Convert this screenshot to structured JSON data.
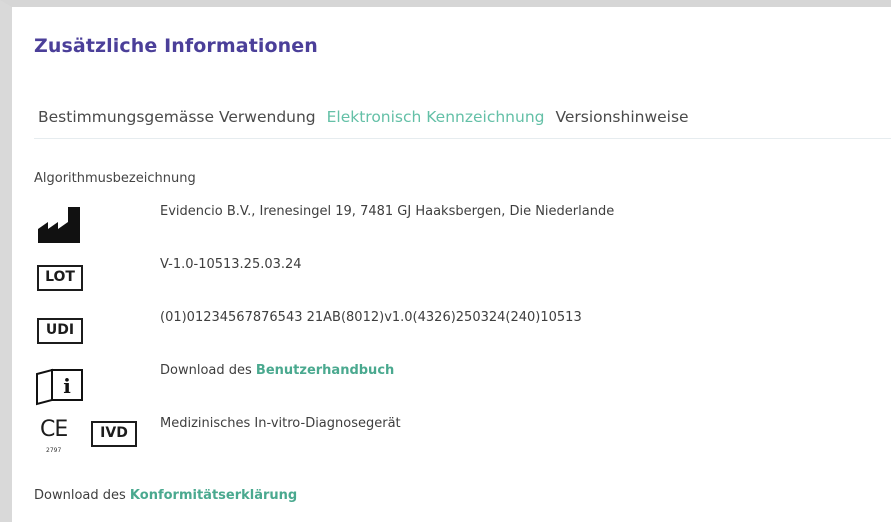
{
  "section": {
    "title": "Zusätzliche Informationen"
  },
  "tabs": [
    {
      "label": "Bestimmungsgemässe Verwendung",
      "active": false
    },
    {
      "label": "Elektronisch Kennzeichnung",
      "active": true
    },
    {
      "label": "Versionshinweise",
      "active": false
    }
  ],
  "label": {
    "algorithm": "Algorithmusbezeichnung"
  },
  "rows": {
    "manufacturer": {
      "icon": "manufacturer-factory-icon",
      "text": "Evidencio B.V., Irenesingel 19, 7481 GJ Haaksbergen, Die Niederlande"
    },
    "lot": {
      "icon": "lot-icon",
      "symbol": "LOT",
      "text": "V-1.0-10513.25.03.24"
    },
    "udi": {
      "icon": "udi-icon",
      "symbol": "UDI",
      "text": "(01)01234567876543 21AB(8012)v1.0(4326)250324(240)10513"
    },
    "manual": {
      "icon": "consult-instructions-icon",
      "symbol": "i",
      "prefix": "Download des ",
      "link": "Benutzerhandbuch"
    },
    "ivd": {
      "icon": "ce-ivd-icon",
      "ce": "CE",
      "ce_number": "2797",
      "symbol": "IVD",
      "text": "Medizinisches In-vitro-Diagnosegerät"
    }
  },
  "footer": {
    "prefix": "Download des ",
    "link": "Konformitätserklärung"
  },
  "colors": {
    "title": "#4b3f99",
    "active_tab": "#64c0a7",
    "link": "#4aa98f"
  }
}
